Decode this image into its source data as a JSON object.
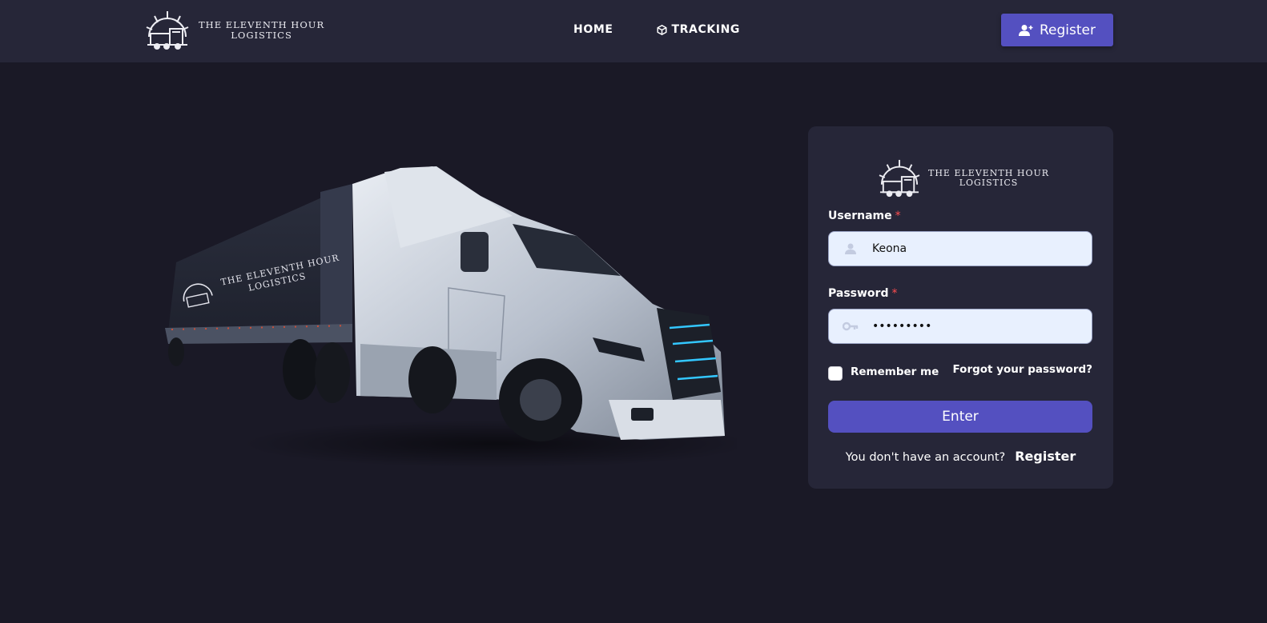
{
  "brand": {
    "line1": "THE ELEVENTH HOUR",
    "line2": "LOGISTICS"
  },
  "nav": {
    "home": "HOME",
    "tracking": "TRACKING",
    "register": "Register"
  },
  "hero": {
    "trailer_line1": "THE ELEVENTH HOUR",
    "trailer_line2": "LOGISTICS"
  },
  "login": {
    "username_label": "Username",
    "username_value": "Keona",
    "password_label": "Password",
    "password_value": "•••••••••",
    "required_mark": "*",
    "remember_label": "Remember me",
    "forgot_label": "Forgot your password?",
    "submit_label": "Enter",
    "no_account_text": "You don't have an account?",
    "register_link": "Register"
  },
  "colors": {
    "background": "#1a1926",
    "surface": "#262638",
    "accent": "#5450c0",
    "input_bg": "#e8f0fe",
    "required": "#ff4d4f"
  }
}
